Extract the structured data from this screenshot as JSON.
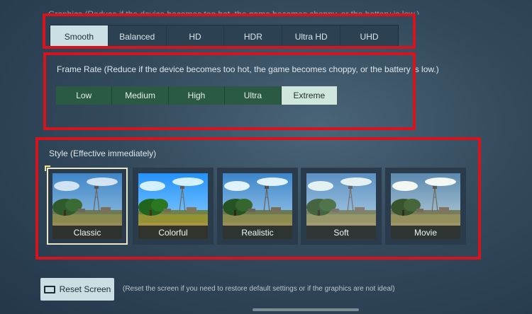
{
  "graphics": {
    "label": "Graphics (Reduce if the device becomes too hot, the game becomes choppy, or the battery is low.)",
    "options": [
      "Smooth",
      "Balanced",
      "HD",
      "HDR",
      "Ultra HD",
      "UHD"
    ],
    "selected": "Smooth"
  },
  "frame_rate": {
    "label": "Frame Rate (Reduce if the device becomes too hot, the game becomes choppy, or the battery is low.)",
    "options": [
      "Low",
      "Medium",
      "High",
      "Ultra",
      "Extreme"
    ],
    "selected": "Extreme"
  },
  "style": {
    "label": "Style (Effective immediately)",
    "options": [
      "Classic",
      "Colorful",
      "Realistic",
      "Soft",
      "Movie"
    ],
    "selected": "Classic"
  },
  "reset": {
    "button_label": "Reset Screen",
    "hint": "(Reset the screen if you need to restore default settings or if the graphics are not ideal)"
  },
  "colors": {
    "highlight_box": "#d7141e",
    "selected_option": "#cbe0e3",
    "frame_rate_bg": "#2b5a44"
  }
}
